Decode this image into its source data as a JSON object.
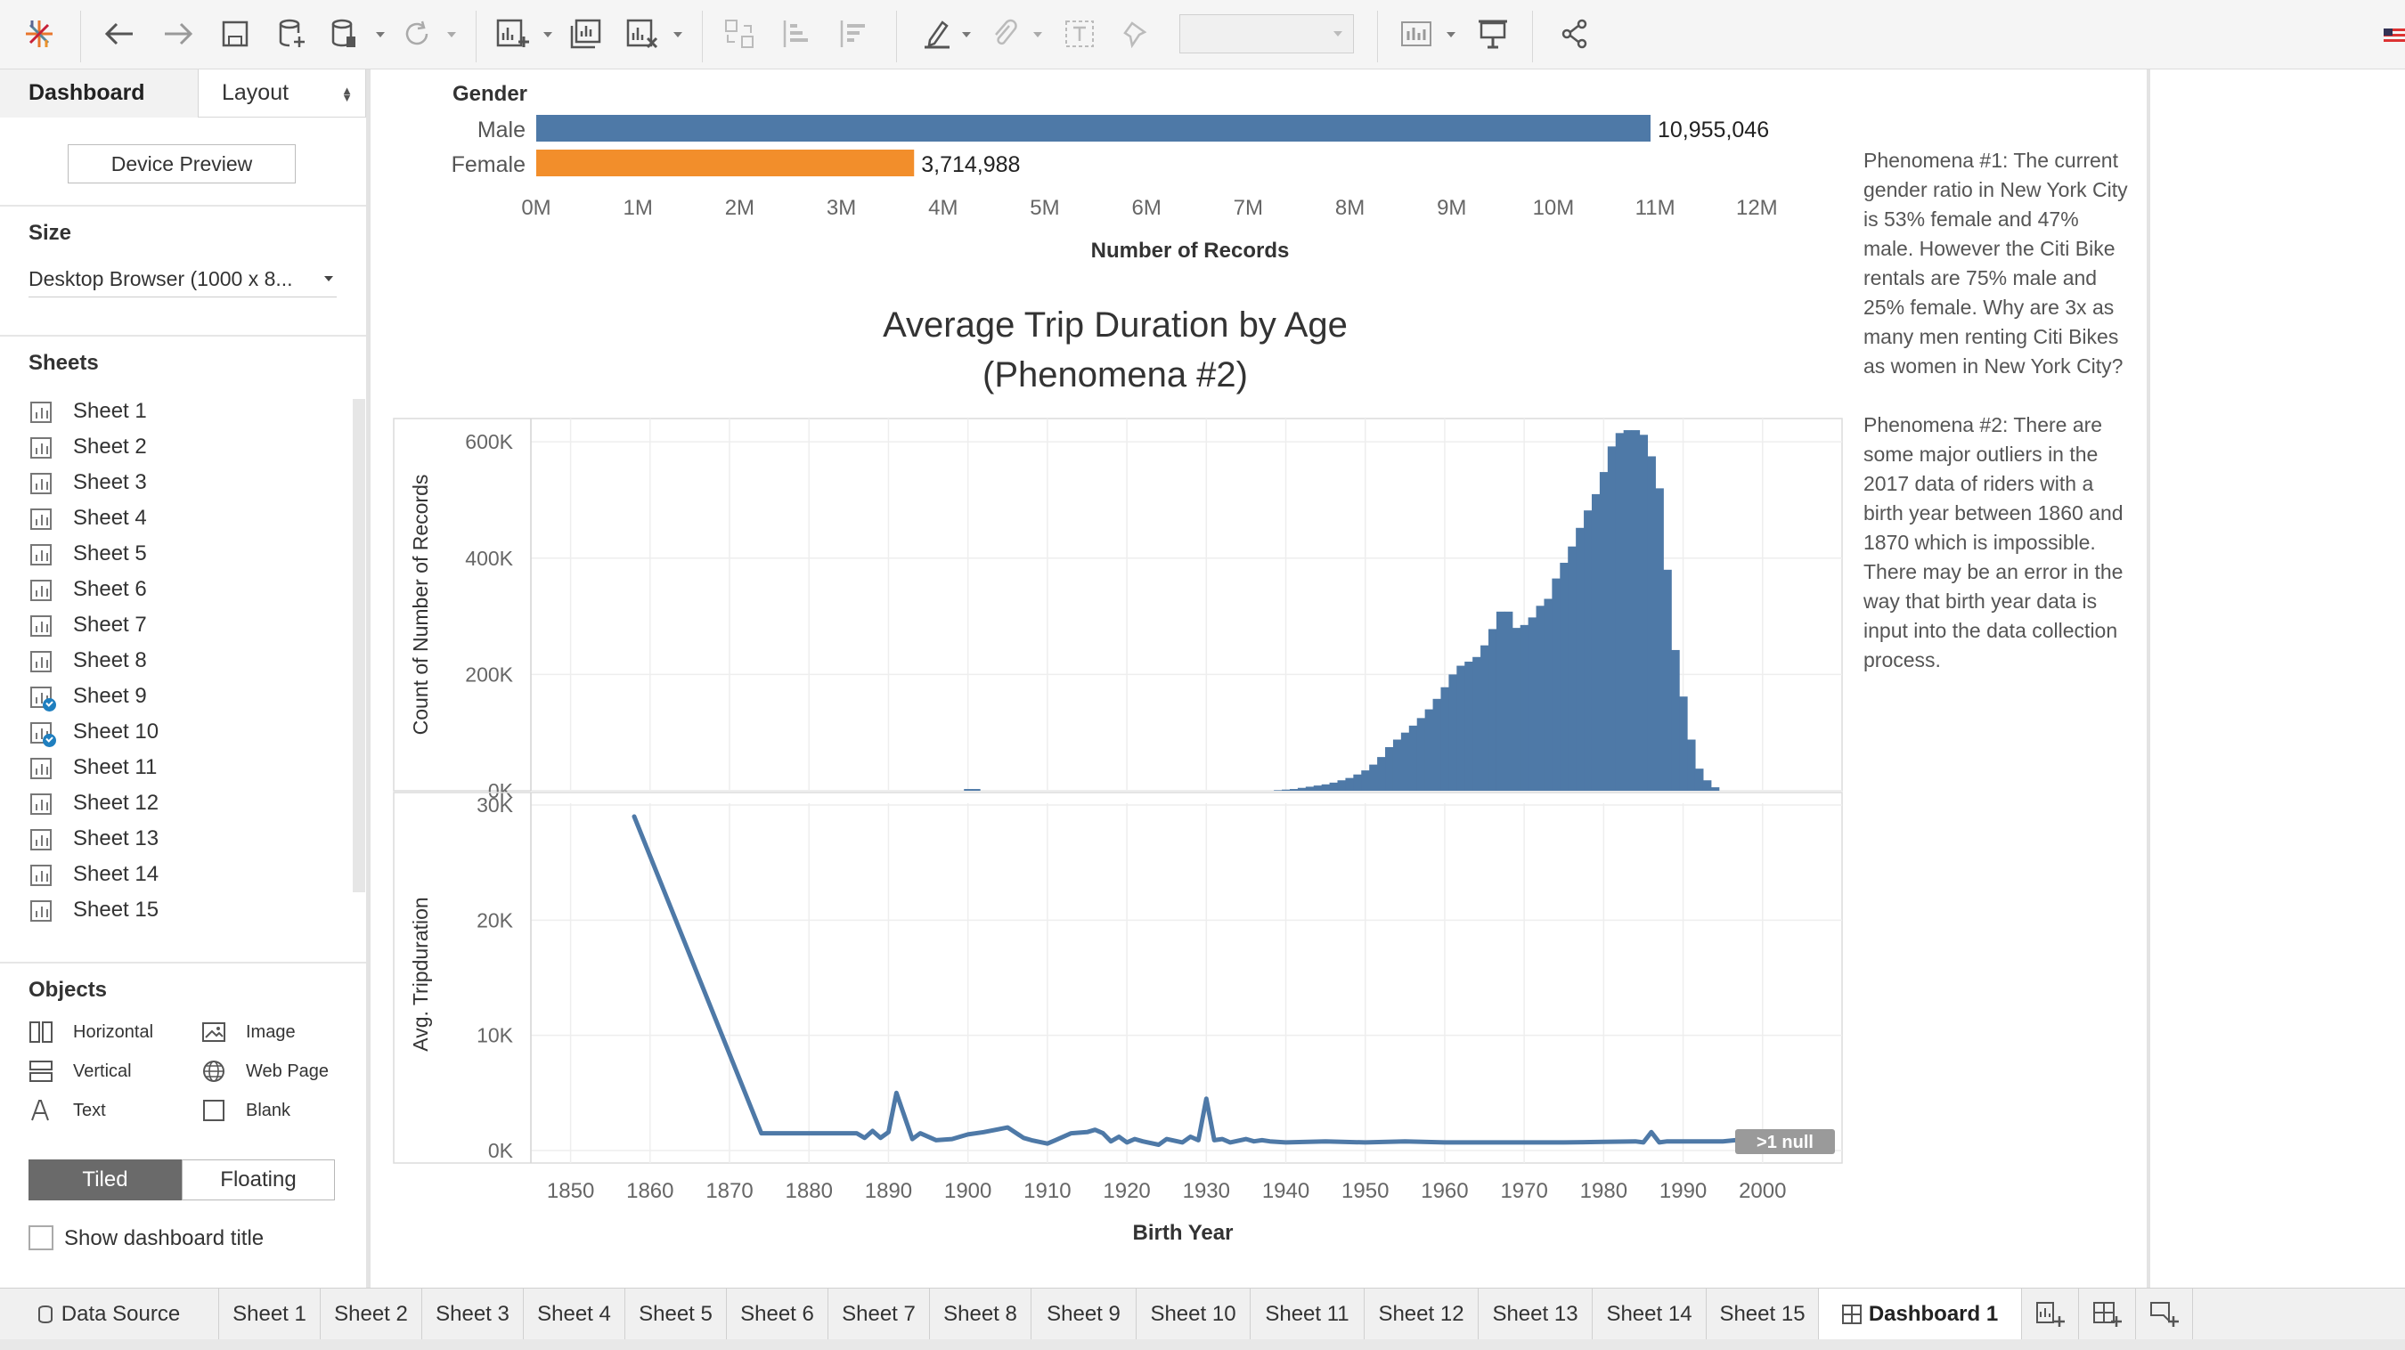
{
  "toolbar": {
    "icons": [
      "tableau-logo-icon",
      "undo-icon",
      "redo-icon",
      "save-icon",
      "new-data-source-icon",
      "pause-auto-updates-icon",
      "refresh-icon",
      "new-worksheet-icon",
      "duplicate-sheet-icon",
      "clear-sheet-icon",
      "swap-icon",
      "sort-ascending-icon",
      "sort-descending-icon",
      "highlight-icon",
      "group-icon",
      "show-labels-icon",
      "fix-axes-icon",
      "fit-dropdown",
      "show-me-icon",
      "presentation-mode-icon",
      "share-icon"
    ],
    "fit_value": ""
  },
  "sidebar": {
    "tab_dashboard": "Dashboard",
    "tab_layout": "Layout",
    "device_preview": "Device Preview",
    "size_heading": "Size",
    "size_value": "Desktop Browser (1000 x 8...",
    "sheets_heading": "Sheets",
    "sheets": [
      {
        "label": "Sheet 1",
        "used": false
      },
      {
        "label": "Sheet 2",
        "used": false
      },
      {
        "label": "Sheet 3",
        "used": false
      },
      {
        "label": "Sheet 4",
        "used": false
      },
      {
        "label": "Sheet 5",
        "used": false
      },
      {
        "label": "Sheet 6",
        "used": false
      },
      {
        "label": "Sheet 7",
        "used": false
      },
      {
        "label": "Sheet 8",
        "used": false
      },
      {
        "label": "Sheet 9",
        "used": true
      },
      {
        "label": "Sheet 10",
        "used": true
      },
      {
        "label": "Sheet 11",
        "used": false
      },
      {
        "label": "Sheet 12",
        "used": false
      },
      {
        "label": "Sheet 13",
        "used": false
      },
      {
        "label": "Sheet 14",
        "used": false
      },
      {
        "label": "Sheet 15",
        "used": false
      }
    ],
    "objects_heading": "Objects",
    "objects": {
      "horizontal": "Horizontal",
      "image": "Image",
      "vertical": "Vertical",
      "web_page": "Web Page",
      "text": "Text",
      "blank": "Blank"
    },
    "tiled": "Tiled",
    "floating": "Floating",
    "show_dashboard_title": "Show dashboard title"
  },
  "dashboard": {
    "phenomena_1": "Phenomena #1:  The current gender ratio in New York City is 53% female and 47% male. However the Citi Bike rentals are 75% male and 25% female. Why are 3x as many men renting Citi Bikes as women in New York City?",
    "phenomena_2": "Phenomena #2: There are some major outliers in the 2017 data of riders with a birth year between 1860 and 1870 which is impossible. There may be an error in the way that birth year data is input into the data collection process."
  },
  "colors": {
    "male": "#4e79a7",
    "female": "#f28e2b",
    "series": "#4e79a7",
    "null_badge": "#9a9a9a"
  },
  "chart_data": [
    {
      "type": "bar",
      "orientation": "horizontal",
      "row_header": "Gender",
      "categories": [
        "Male",
        "Female"
      ],
      "values": [
        10955046,
        3714988
      ],
      "value_labels": [
        "10,955,046",
        "3,714,988"
      ],
      "colors": [
        "#4e79a7",
        "#f28e2b"
      ],
      "xlabel": "Number of Records",
      "xlim": [
        0,
        12400000
      ],
      "xticks": [
        0,
        1000000,
        2000000,
        3000000,
        4000000,
        5000000,
        6000000,
        7000000,
        8000000,
        9000000,
        10000000,
        11000000,
        12000000
      ],
      "xtick_labels": [
        "0M",
        "1M",
        "2M",
        "3M",
        "4M",
        "5M",
        "6M",
        "7M",
        "8M",
        "9M",
        "10M",
        "11M",
        "12M"
      ],
      "grid": false
    },
    {
      "type": "bar",
      "title": "Average Trip Duration by Age\n(Phenomena #2)",
      "ylabel": "Count of Number of Records",
      "xlabel": "Birth Year",
      "xlim": [
        1845,
        2010
      ],
      "ylim": [
        0,
        640000
      ],
      "yticks": [
        0,
        200000,
        400000,
        600000
      ],
      "ytick_labels": [
        "0K",
        "200K",
        "400K",
        "600K"
      ],
      "grid": true,
      "x": [
        1900,
        1901,
        1939,
        1940,
        1941,
        1942,
        1943,
        1944,
        1945,
        1946,
        1947,
        1948,
        1949,
        1950,
        1951,
        1952,
        1953,
        1954,
        1955,
        1956,
        1957,
        1958,
        1959,
        1960,
        1961,
        1962,
        1963,
        1964,
        1965,
        1966,
        1967,
        1968,
        1969,
        1970,
        1971,
        1972,
        1973,
        1974,
        1975,
        1976,
        1977,
        1978,
        1979,
        1980,
        1981,
        1982,
        1983,
        1984,
        1985,
        1986,
        1987,
        1988,
        1989,
        1990,
        1991,
        1992,
        1993,
        1994,
        1995,
        1996,
        1997,
        1998,
        1999,
        2000,
        2001
      ],
      "values": [
        3000,
        3000,
        1000,
        2000,
        3000,
        5000,
        7000,
        9000,
        11000,
        14000,
        18000,
        22000,
        28000,
        35000,
        45000,
        58000,
        75000,
        88000,
        100000,
        112000,
        125000,
        140000,
        158000,
        178000,
        200000,
        215000,
        222000,
        230000,
        250000,
        278000,
        308000,
        308000,
        280000,
        285000,
        298000,
        318000,
        330000,
        365000,
        392000,
        420000,
        452000,
        482000,
        510000,
        548000,
        592000,
        615000,
        620000,
        620000,
        612000,
        575000,
        520000,
        380000,
        242000,
        162000,
        88000,
        38000,
        18000,
        6000
      ]
    },
    {
      "type": "line",
      "ylabel": "Avg. Tripduration",
      "xlabel": "Birth Year",
      "xlim": [
        1845,
        2010
      ],
      "ylim": [
        0,
        30000
      ],
      "yticks": [
        0,
        10000,
        20000,
        30000
      ],
      "ytick_labels": [
        "0K",
        "10K",
        "20K",
        "30K"
      ],
      "xticks": [
        1850,
        1860,
        1870,
        1880,
        1890,
        1900,
        1910,
        1920,
        1930,
        1940,
        1950,
        1960,
        1970,
        1980,
        1990,
        2000
      ],
      "grid": true,
      "null_badge": ">1 null",
      "x": [
        1858,
        1874,
        1876,
        1880,
        1884,
        1886,
        1887,
        1888,
        1889,
        1890,
        1891,
        1893,
        1894,
        1896,
        1898,
        1900,
        1902,
        1905,
        1907,
        1908,
        1910,
        1911,
        1913,
        1915,
        1916,
        1917,
        1918,
        1919,
        1920,
        1921,
        1922,
        1924,
        1925,
        1927,
        1928,
        1929,
        1930,
        1931,
        1932,
        1933,
        1935,
        1936,
        1937,
        1938,
        1940,
        1945,
        1950,
        1955,
        1960,
        1965,
        1970,
        1975,
        1980,
        1984,
        1985,
        1986,
        1987,
        1988,
        1990,
        1995,
        1998,
        2000
      ],
      "values": [
        29000,
        1500,
        1500,
        1500,
        1500,
        1500,
        1100,
        1700,
        1100,
        1600,
        5000,
        1000,
        1500,
        900,
        1000,
        1400,
        1600,
        2000,
        1100,
        900,
        600,
        900,
        1500,
        1600,
        1800,
        1500,
        800,
        1200,
        700,
        1000,
        800,
        500,
        1000,
        700,
        1200,
        900,
        4500,
        900,
        1000,
        700,
        1000,
        800,
        900,
        800,
        700,
        800,
        700,
        800,
        700,
        700,
        700,
        700,
        750,
        800,
        700,
        1600,
        700,
        800,
        800,
        800,
        1000,
        1000
      ]
    }
  ],
  "tabs": [
    {
      "label": "Data Source",
      "active": false
    },
    {
      "label": "Sheet 1",
      "active": false
    },
    {
      "label": "Sheet 2",
      "active": false
    },
    {
      "label": "Sheet 3",
      "active": false
    },
    {
      "label": "Sheet 4",
      "active": false
    },
    {
      "label": "Sheet 5",
      "active": false
    },
    {
      "label": "Sheet 6",
      "active": false
    },
    {
      "label": "Sheet 7",
      "active": false
    },
    {
      "label": "Sheet 8",
      "active": false
    },
    {
      "label": "Sheet 9",
      "active": false
    },
    {
      "label": "Sheet 10",
      "active": false
    },
    {
      "label": "Sheet 11",
      "active": false
    },
    {
      "label": "Sheet 12",
      "active": false
    },
    {
      "label": "Sheet 13",
      "active": false
    },
    {
      "label": "Sheet 14",
      "active": false
    },
    {
      "label": "Sheet 15",
      "active": false
    },
    {
      "label": "Dashboard 1",
      "active": true
    }
  ]
}
